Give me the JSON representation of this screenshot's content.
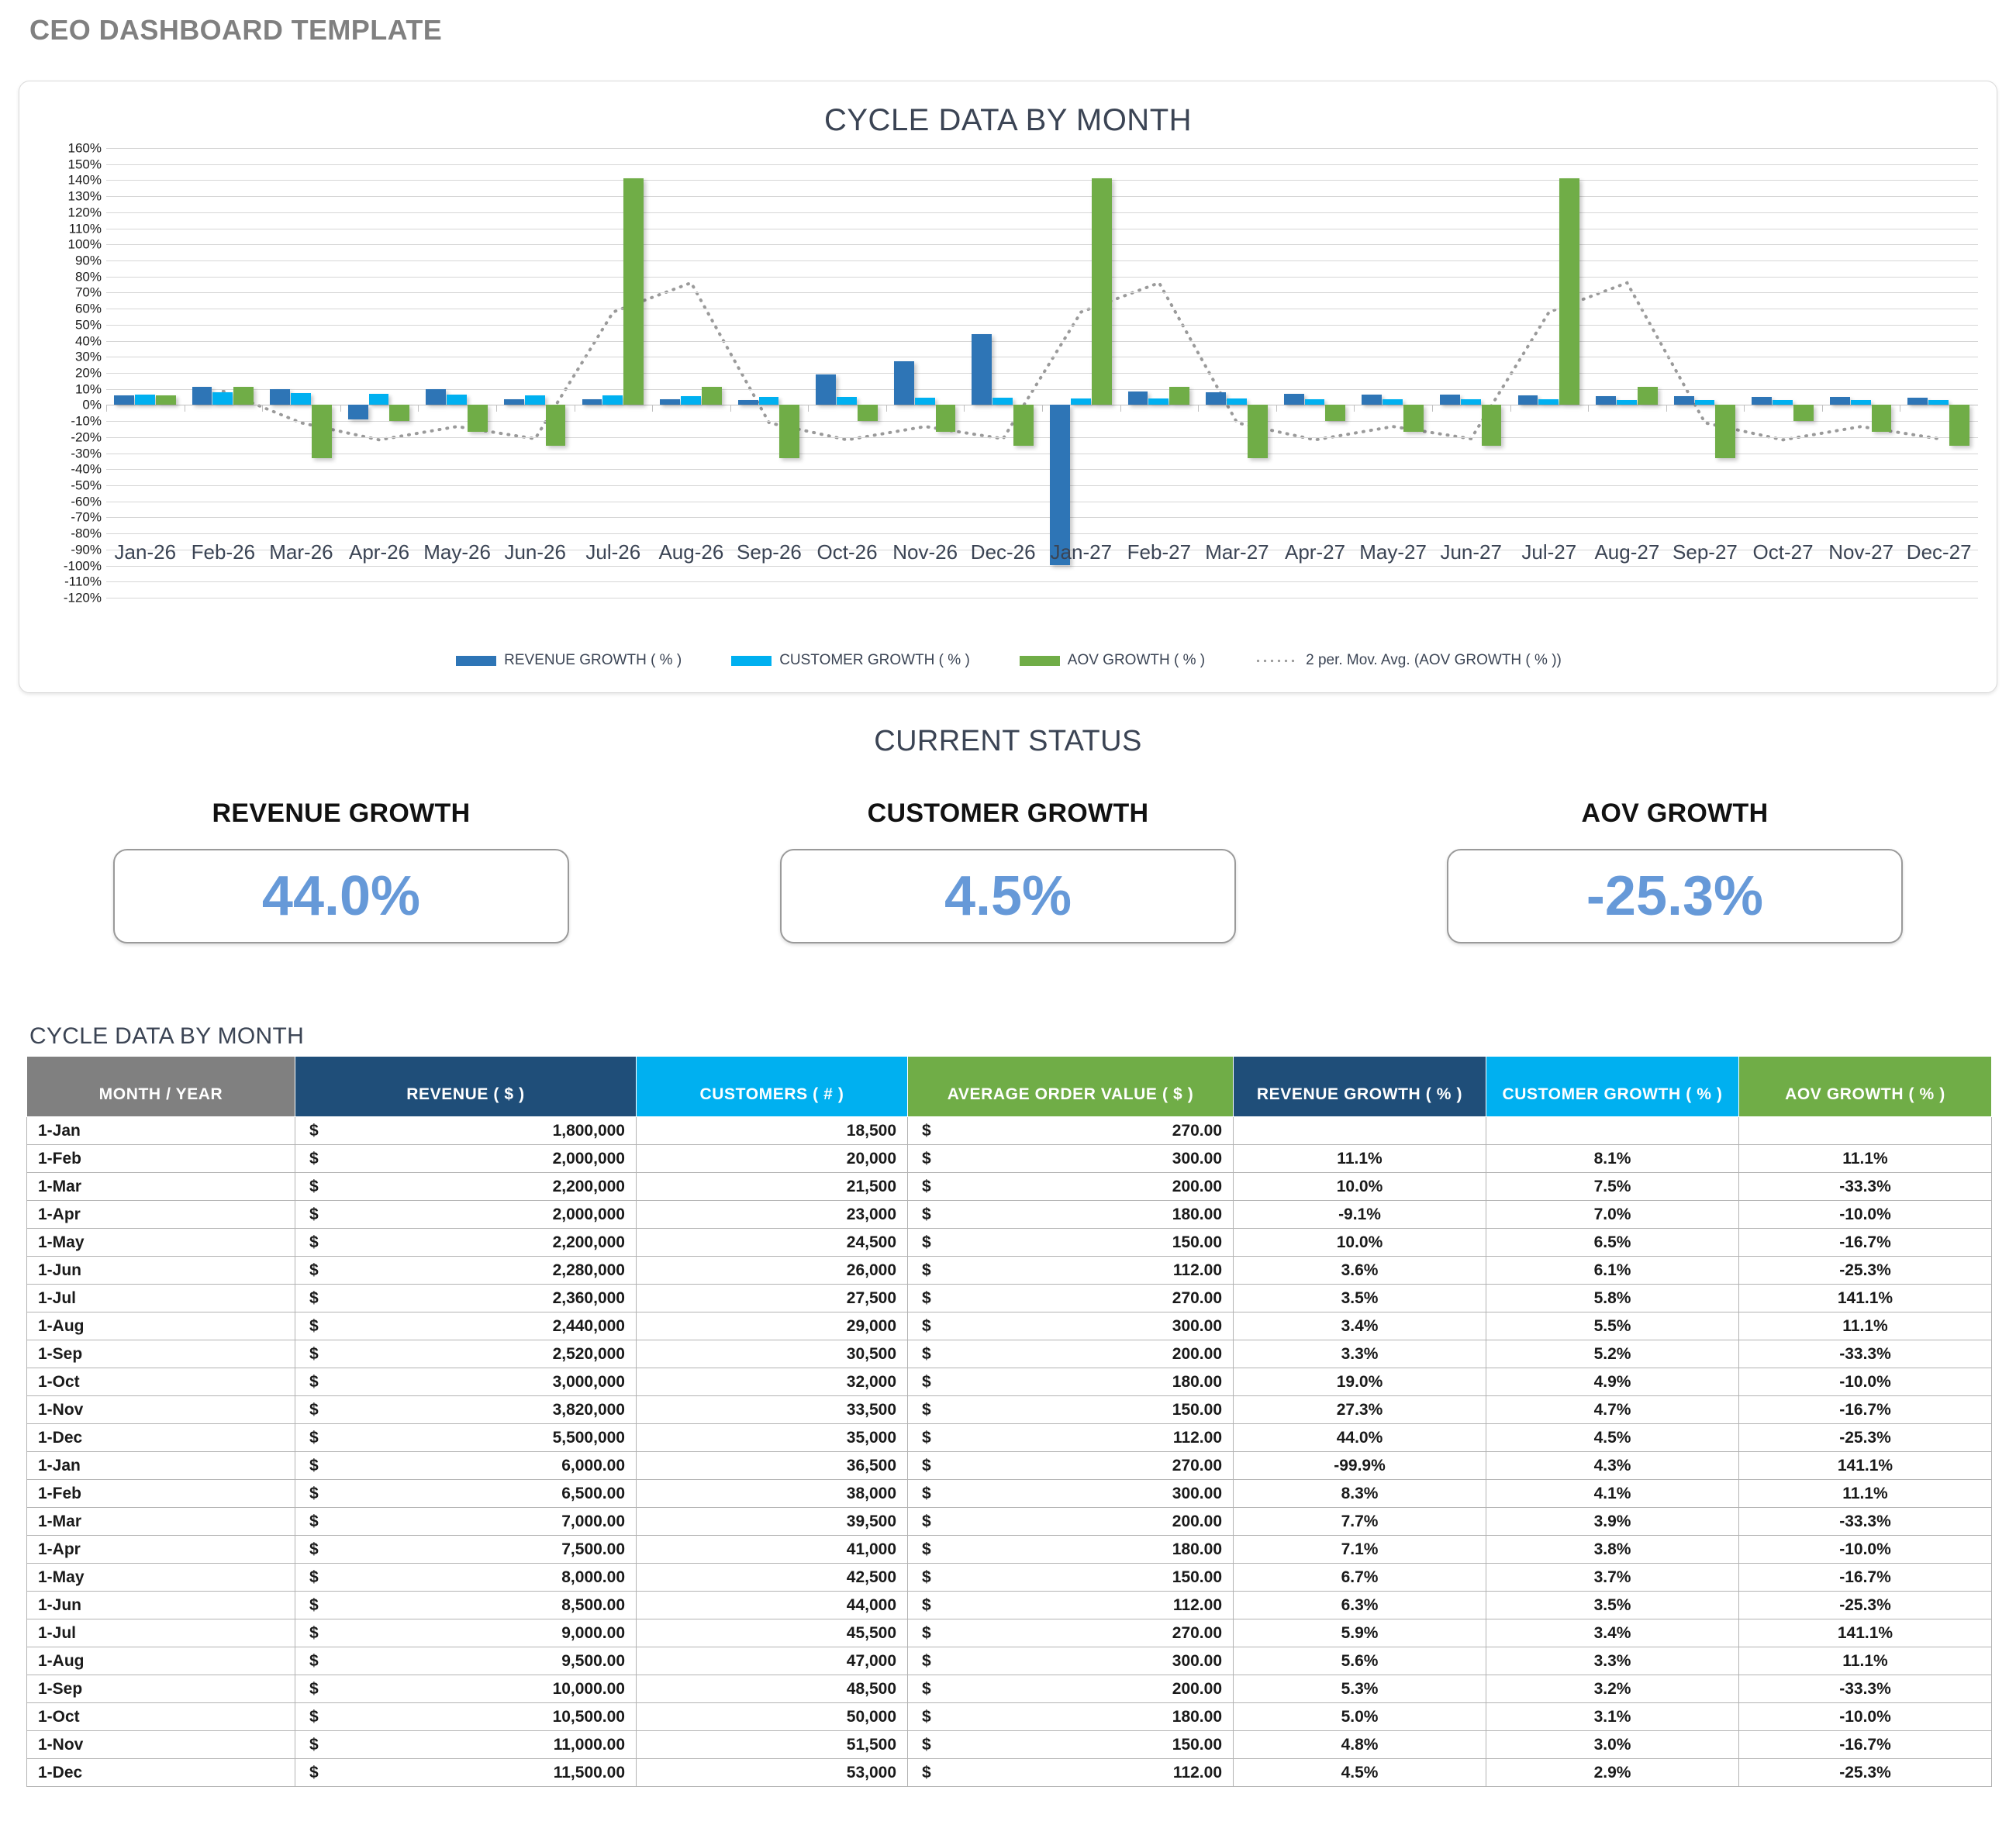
{
  "page_title": "CEO DASHBOARD TEMPLATE",
  "colors": {
    "revenue": "#2E75B6",
    "customer": "#00B0F0",
    "aov": "#70AD47",
    "movavg": "#9A9A9A",
    "header_month": "#808080",
    "header_revenue": "#1F4E79",
    "header_customers": "#00B0F0",
    "header_aov": "#70AD47",
    "kpi_value": "#6699D8",
    "title_gray": "#808080",
    "heading_slate": "#3B4454"
  },
  "chart_card": {
    "title": "CYCLE DATA BY MONTH"
  },
  "status": {
    "heading": "CURRENT STATUS",
    "cards": [
      {
        "label": "REVENUE GROWTH",
        "value": "44.0%"
      },
      {
        "label": "CUSTOMER GROWTH",
        "value": "4.5%"
      },
      {
        "label": "AOV GROWTH",
        "value": "-25.3%"
      }
    ]
  },
  "table": {
    "caption": "CYCLE DATA BY MONTH",
    "columns": [
      "MONTH / YEAR",
      "REVENUE ( $ )",
      "CUSTOMERS ( # )",
      "AVERAGE ORDER VALUE ( $ )",
      "REVENUE GROWTH ( % )",
      "CUSTOMER GROWTH ( % )",
      "AOV GROWTH ( % )"
    ],
    "currency_symbol": "$",
    "rows": [
      {
        "month": "1-Jan",
        "revenue": "1,800,000",
        "customers": "18,500",
        "aov": "270.00",
        "rev_growth": "",
        "cust_growth": "",
        "aov_growth": ""
      },
      {
        "month": "1-Feb",
        "revenue": "2,000,000",
        "customers": "20,000",
        "aov": "300.00",
        "rev_growth": "11.1%",
        "cust_growth": "8.1%",
        "aov_growth": "11.1%"
      },
      {
        "month": "1-Mar",
        "revenue": "2,200,000",
        "customers": "21,500",
        "aov": "200.00",
        "rev_growth": "10.0%",
        "cust_growth": "7.5%",
        "aov_growth": "-33.3%"
      },
      {
        "month": "1-Apr",
        "revenue": "2,000,000",
        "customers": "23,000",
        "aov": "180.00",
        "rev_growth": "-9.1%",
        "cust_growth": "7.0%",
        "aov_growth": "-10.0%"
      },
      {
        "month": "1-May",
        "revenue": "2,200,000",
        "customers": "24,500",
        "aov": "150.00",
        "rev_growth": "10.0%",
        "cust_growth": "6.5%",
        "aov_growth": "-16.7%"
      },
      {
        "month": "1-Jun",
        "revenue": "2,280,000",
        "customers": "26,000",
        "aov": "112.00",
        "rev_growth": "3.6%",
        "cust_growth": "6.1%",
        "aov_growth": "-25.3%"
      },
      {
        "month": "1-Jul",
        "revenue": "2,360,000",
        "customers": "27,500",
        "aov": "270.00",
        "rev_growth": "3.5%",
        "cust_growth": "5.8%",
        "aov_growth": "141.1%"
      },
      {
        "month": "1-Aug",
        "revenue": "2,440,000",
        "customers": "29,000",
        "aov": "300.00",
        "rev_growth": "3.4%",
        "cust_growth": "5.5%",
        "aov_growth": "11.1%"
      },
      {
        "month": "1-Sep",
        "revenue": "2,520,000",
        "customers": "30,500",
        "aov": "200.00",
        "rev_growth": "3.3%",
        "cust_growth": "5.2%",
        "aov_growth": "-33.3%"
      },
      {
        "month": "1-Oct",
        "revenue": "3,000,000",
        "customers": "32,000",
        "aov": "180.00",
        "rev_growth": "19.0%",
        "cust_growth": "4.9%",
        "aov_growth": "-10.0%"
      },
      {
        "month": "1-Nov",
        "revenue": "3,820,000",
        "customers": "33,500",
        "aov": "150.00",
        "rev_growth": "27.3%",
        "cust_growth": "4.7%",
        "aov_growth": "-16.7%"
      },
      {
        "month": "1-Dec",
        "revenue": "5,500,000",
        "customers": "35,000",
        "aov": "112.00",
        "rev_growth": "44.0%",
        "cust_growth": "4.5%",
        "aov_growth": "-25.3%"
      },
      {
        "month": "1-Jan",
        "revenue": "6,000.00",
        "customers": "36,500",
        "aov": "270.00",
        "rev_growth": "-99.9%",
        "cust_growth": "4.3%",
        "aov_growth": "141.1%"
      },
      {
        "month": "1-Feb",
        "revenue": "6,500.00",
        "customers": "38,000",
        "aov": "300.00",
        "rev_growth": "8.3%",
        "cust_growth": "4.1%",
        "aov_growth": "11.1%"
      },
      {
        "month": "1-Mar",
        "revenue": "7,000.00",
        "customers": "39,500",
        "aov": "200.00",
        "rev_growth": "7.7%",
        "cust_growth": "3.9%",
        "aov_growth": "-33.3%"
      },
      {
        "month": "1-Apr",
        "revenue": "7,500.00",
        "customers": "41,000",
        "aov": "180.00",
        "rev_growth": "7.1%",
        "cust_growth": "3.8%",
        "aov_growth": "-10.0%"
      },
      {
        "month": "1-May",
        "revenue": "8,000.00",
        "customers": "42,500",
        "aov": "150.00",
        "rev_growth": "6.7%",
        "cust_growth": "3.7%",
        "aov_growth": "-16.7%"
      },
      {
        "month": "1-Jun",
        "revenue": "8,500.00",
        "customers": "44,000",
        "aov": "112.00",
        "rev_growth": "6.3%",
        "cust_growth": "3.5%",
        "aov_growth": "-25.3%"
      },
      {
        "month": "1-Jul",
        "revenue": "9,000.00",
        "customers": "45,500",
        "aov": "270.00",
        "rev_growth": "5.9%",
        "cust_growth": "3.4%",
        "aov_growth": "141.1%"
      },
      {
        "month": "1-Aug",
        "revenue": "9,500.00",
        "customers": "47,000",
        "aov": "300.00",
        "rev_growth": "5.6%",
        "cust_growth": "3.3%",
        "aov_growth": "11.1%"
      },
      {
        "month": "1-Sep",
        "revenue": "10,000.00",
        "customers": "48,500",
        "aov": "200.00",
        "rev_growth": "5.3%",
        "cust_growth": "3.2%",
        "aov_growth": "-33.3%"
      },
      {
        "month": "1-Oct",
        "revenue": "10,500.00",
        "customers": "50,000",
        "aov": "180.00",
        "rev_growth": "5.0%",
        "cust_growth": "3.1%",
        "aov_growth": "-10.0%"
      },
      {
        "month": "1-Nov",
        "revenue": "11,000.00",
        "customers": "51,500",
        "aov": "150.00",
        "rev_growth": "4.8%",
        "cust_growth": "3.0%",
        "aov_growth": "-16.7%"
      },
      {
        "month": "1-Dec",
        "revenue": "11,500.00",
        "customers": "53,000",
        "aov": "112.00",
        "rev_growth": "4.5%",
        "cust_growth": "2.9%",
        "aov_growth": "-25.3%"
      }
    ]
  },
  "chart_data": {
    "type": "bar",
    "title": "CYCLE DATA BY MONTH",
    "xlabel": "",
    "ylabel": "",
    "ylim": [
      -120,
      160
    ],
    "ytick_step": 10,
    "grid": true,
    "legend_position": "bottom",
    "categories": [
      "Jan-26",
      "Feb-26",
      "Mar-26",
      "Apr-26",
      "May-26",
      "Jun-26",
      "Jul-26",
      "Aug-26",
      "Sep-26",
      "Oct-26",
      "Nov-26",
      "Dec-26",
      "Jan-27",
      "Feb-27",
      "Mar-27",
      "Apr-27",
      "May-27",
      "Jun-27",
      "Jul-27",
      "Aug-27",
      "Sep-27",
      "Oct-27",
      "Nov-27",
      "Dec-27"
    ],
    "ytick_labels": [
      "160%",
      "150%",
      "140%",
      "130%",
      "120%",
      "110%",
      "100%",
      "90%",
      "80%",
      "70%",
      "60%",
      "50%",
      "40%",
      "30%",
      "20%",
      "10%",
      "0%",
      "-10%",
      "-20%",
      "-30%",
      "-40%",
      "-50%",
      "-60%",
      "-70%",
      "-80%",
      "-90%",
      "-100%",
      "-110%",
      "-120%"
    ],
    "series": [
      {
        "name": "REVENUE GROWTH  ( % )",
        "color": "#2E75B6",
        "values": [
          6.0,
          11.1,
          10.0,
          -9.1,
          10.0,
          3.6,
          3.5,
          3.4,
          3.3,
          19.0,
          27.3,
          44.0,
          -99.9,
          8.3,
          7.7,
          7.1,
          6.7,
          6.3,
          5.9,
          5.6,
          5.3,
          5.0,
          4.8,
          4.5
        ]
      },
      {
        "name": "CUSTOMER GROWTH  ( % )",
        "color": "#00B0F0",
        "values": [
          6.5,
          8.1,
          7.5,
          7.0,
          6.5,
          6.1,
          5.8,
          5.5,
          5.2,
          4.9,
          4.7,
          4.5,
          4.3,
          4.1,
          3.9,
          3.8,
          3.7,
          3.5,
          3.4,
          3.3,
          3.2,
          3.1,
          3.0,
          2.9
        ]
      },
      {
        "name": "AOV GROWTH  ( % )",
        "color": "#70AD47",
        "values": [
          6.0,
          11.1,
          -33.3,
          -10.0,
          -16.7,
          -25.3,
          141.1,
          11.1,
          -33.3,
          -10.0,
          -16.7,
          -25.3,
          141.1,
          11.1,
          -33.3,
          -10.0,
          -16.7,
          -25.3,
          141.1,
          11.1,
          -33.3,
          -10.0,
          -16.7,
          -25.3
        ]
      },
      {
        "name": "2 per. Mov. Avg. (AOV GROWTH  ( % ))",
        "color": "#9A9A9A",
        "type": "line",
        "style": "dotted",
        "values": [
          null,
          8.6,
          -11.1,
          -21.7,
          -13.4,
          -21.0,
          57.9,
          76.1,
          -11.1,
          -21.7,
          -13.4,
          -21.0,
          57.9,
          76.1,
          -11.1,
          -21.7,
          -13.4,
          -21.0,
          57.9,
          76.1,
          -11.1,
          -21.7,
          -13.4,
          -21.0
        ]
      }
    ]
  }
}
